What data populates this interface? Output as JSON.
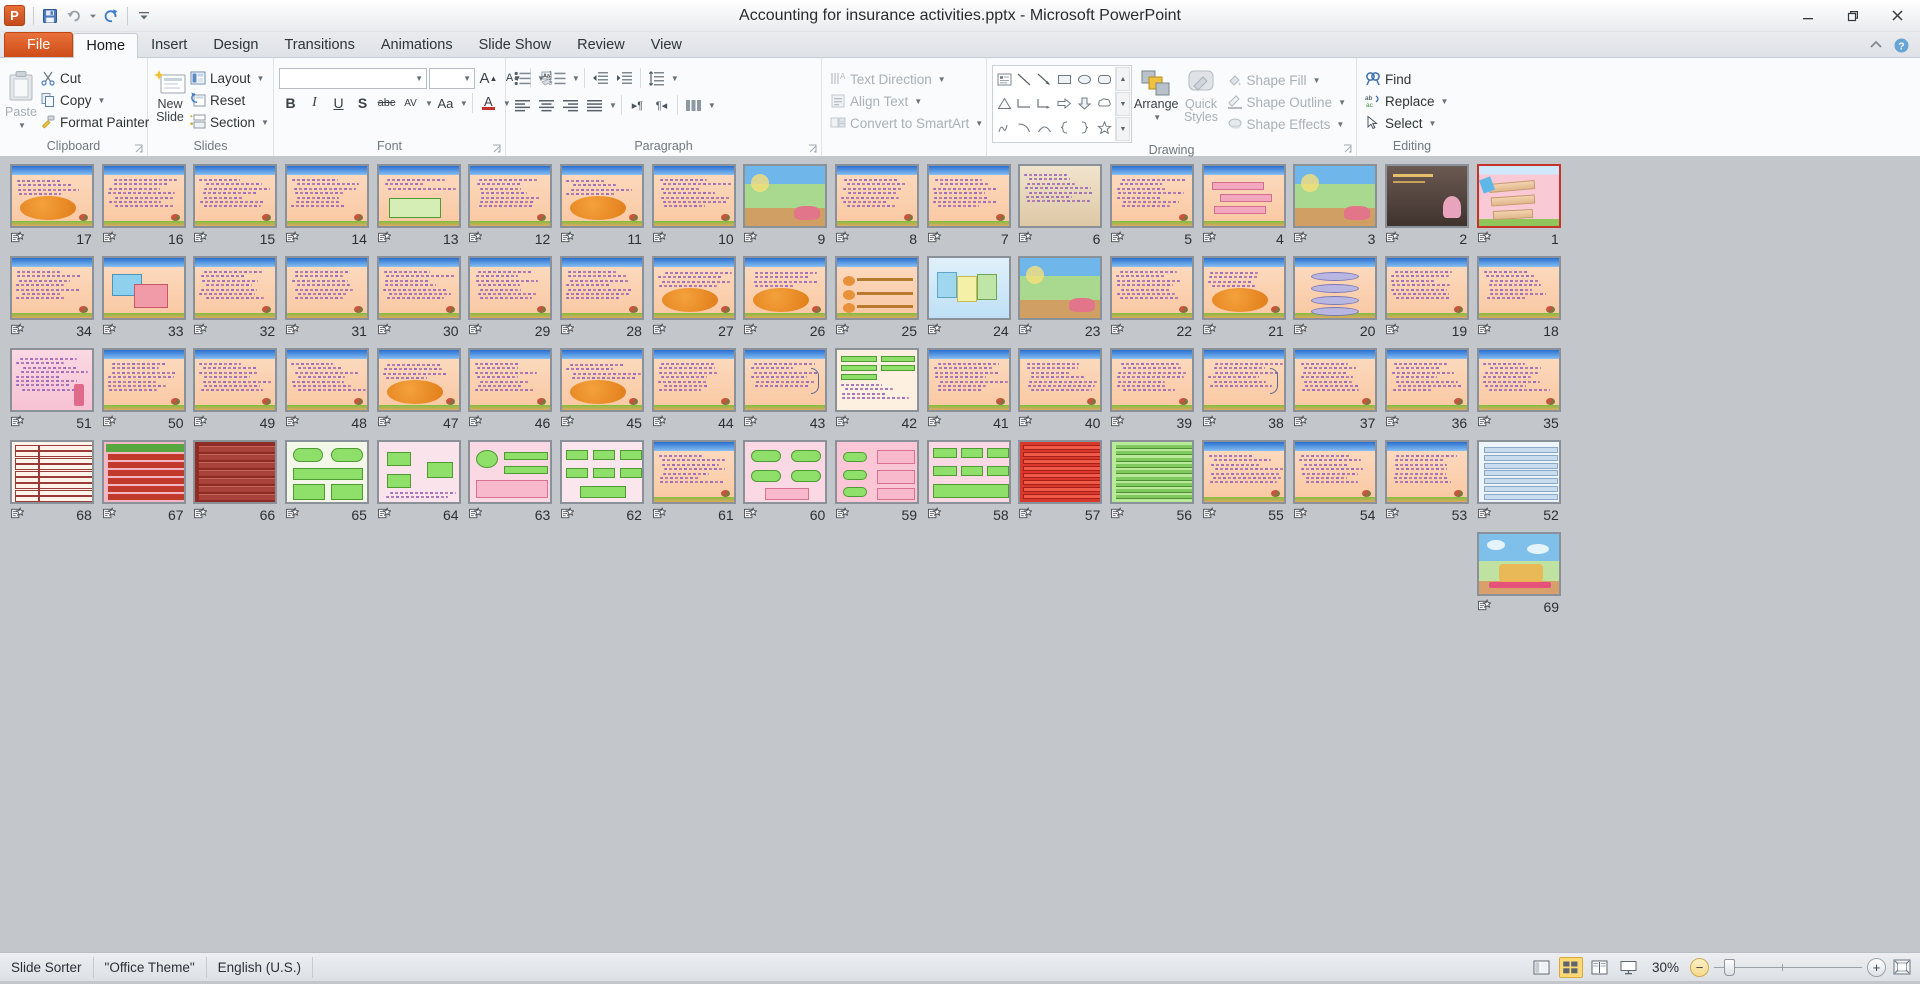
{
  "window": {
    "title": "Accounting for insurance activities.pptx  -  Microsoft PowerPoint",
    "minimize_label": "–",
    "restore_label": "❐",
    "close_label": "✕"
  },
  "quick_access": {
    "app_icon_letter": "P",
    "items": [
      {
        "name": "save-button",
        "label": "Save"
      },
      {
        "name": "undo-button",
        "label": "Undo"
      },
      {
        "name": "undo-dropdown",
        "label": "Undo options"
      },
      {
        "name": "redo-button",
        "label": "Redo"
      },
      {
        "name": "customize-qat-button",
        "label": "Customize Quick Access Toolbar"
      }
    ]
  },
  "tabs": [
    {
      "label": "File",
      "type": "file"
    },
    {
      "label": "Home",
      "type": "active"
    },
    {
      "label": "Insert",
      "type": "normal"
    },
    {
      "label": "Design",
      "type": "normal"
    },
    {
      "label": "Transitions",
      "type": "normal"
    },
    {
      "label": "Animations",
      "type": "normal"
    },
    {
      "label": "Slide Show",
      "type": "normal"
    },
    {
      "label": "Review",
      "type": "normal"
    },
    {
      "label": "View",
      "type": "normal"
    }
  ],
  "ribbon": {
    "groups": [
      {
        "title": "Clipboard"
      },
      {
        "title": "Slides"
      },
      {
        "title": "Font"
      },
      {
        "title": "Paragraph"
      },
      {
        "title": "Drawing"
      },
      {
        "title": "Editing"
      }
    ],
    "clipboard": {
      "paste_label": "Paste",
      "cut_label": "Cut",
      "copy_label": "Copy",
      "format_painter_label": "Format Painter"
    },
    "slides": {
      "new_slide_line1": "New",
      "new_slide_line2": "Slide",
      "layout_label": "Layout",
      "reset_label": "Reset",
      "section_label": "Section"
    },
    "font": {
      "font_name_value": "",
      "font_size_value": "",
      "bold": "B",
      "italic": "I",
      "underline": "U",
      "shadow": "S",
      "strikethrough": "abc",
      "char_spacing": "AV",
      "change_case": "Aa",
      "font_color": "A",
      "grow_font": "A",
      "shrink_font": "A",
      "clear_formatting": "Clear Formatting"
    },
    "paragraph": {
      "text_direction_label": "Text Direction",
      "align_text_label": "Align Text",
      "convert_smartart_label": "Convert to SmartArt"
    },
    "drawing": {
      "arrange_label": "Arrange",
      "quick_styles_line1": "Quick",
      "quick_styles_line2": "Styles",
      "shape_fill_label": "Shape Fill",
      "shape_outline_label": "Shape Outline",
      "shape_effects_label": "Shape Effects"
    },
    "editing": {
      "find_label": "Find",
      "replace_label": "Replace",
      "select_label": "Select"
    }
  },
  "status_bar": {
    "view_name": "Slide Sorter",
    "theme_name": "\"Office Theme\"",
    "language": "English (U.S.)",
    "zoom_level": "30%",
    "zoom_out_label": "−",
    "zoom_in_label": "+",
    "view_buttons": [
      {
        "name": "view-normal",
        "on": false
      },
      {
        "name": "view-slide-sorter",
        "on": true
      },
      {
        "name": "view-reading",
        "on": false
      },
      {
        "name": "view-slideshow",
        "on": false
      }
    ],
    "fit_window_label": "Fit slide to current window"
  },
  "slides": [
    {
      "n": "17",
      "style": "blob",
      "sel": false
    },
    {
      "n": "16",
      "style": "text",
      "sel": false
    },
    {
      "n": "15",
      "style": "text",
      "sel": false
    },
    {
      "n": "14",
      "style": "text",
      "sel": false
    },
    {
      "n": "13",
      "style": "greenpanel",
      "sel": false
    },
    {
      "n": "12",
      "style": "text",
      "sel": false
    },
    {
      "n": "11",
      "style": "blob",
      "sel": false
    },
    {
      "n": "10",
      "style": "text",
      "sel": false
    },
    {
      "n": "9",
      "style": "photo",
      "sel": false
    },
    {
      "n": "8",
      "style": "text",
      "sel": false
    },
    {
      "n": "7",
      "style": "text",
      "sel": false
    },
    {
      "n": "6",
      "style": "paper",
      "sel": false
    },
    {
      "n": "5",
      "style": "text",
      "sel": false
    },
    {
      "n": "4",
      "style": "banner",
      "sel": false
    },
    {
      "n": "3",
      "style": "photo",
      "sel": false
    },
    {
      "n": "2",
      "style": "dark",
      "sel": false
    },
    {
      "n": "1",
      "style": "title",
      "sel": true
    },
    {
      "n": "34",
      "style": "text",
      "sel": false
    },
    {
      "n": "33",
      "style": "card",
      "sel": false
    },
    {
      "n": "32",
      "style": "text",
      "sel": false
    },
    {
      "n": "31",
      "style": "text",
      "sel": false
    },
    {
      "n": "30",
      "style": "text",
      "sel": false
    },
    {
      "n": "29",
      "style": "text",
      "sel": false
    },
    {
      "n": "28",
      "style": "text",
      "sel": false
    },
    {
      "n": "27",
      "style": "blob",
      "sel": false
    },
    {
      "n": "26",
      "style": "blob",
      "sel": false
    },
    {
      "n": "25",
      "style": "chart",
      "sel": false
    },
    {
      "n": "24",
      "style": "sticky",
      "sel": false
    },
    {
      "n": "23",
      "style": "photo",
      "sel": false
    },
    {
      "n": "22",
      "style": "text",
      "sel": false
    },
    {
      "n": "21",
      "style": "blob",
      "sel": false
    },
    {
      "n": "20",
      "style": "stack",
      "sel": false
    },
    {
      "n": "19",
      "style": "text",
      "sel": false
    },
    {
      "n": "18",
      "style": "text",
      "sel": false
    },
    {
      "n": "51",
      "style": "pinktext",
      "sel": false
    },
    {
      "n": "50",
      "style": "text",
      "sel": false
    },
    {
      "n": "49",
      "style": "text",
      "sel": false
    },
    {
      "n": "48",
      "style": "text",
      "sel": false
    },
    {
      "n": "47",
      "style": "blob",
      "sel": false
    },
    {
      "n": "46",
      "style": "text",
      "sel": false
    },
    {
      "n": "45",
      "style": "blob",
      "sel": false
    },
    {
      "n": "44",
      "style": "text",
      "sel": false
    },
    {
      "n": "43",
      "style": "brace",
      "sel": false
    },
    {
      "n": "42",
      "style": "greentable",
      "sel": false
    },
    {
      "n": "41",
      "style": "text",
      "sel": false
    },
    {
      "n": "40",
      "style": "text",
      "sel": false
    },
    {
      "n": "39",
      "style": "text",
      "sel": false
    },
    {
      "n": "38",
      "style": "brace",
      "sel": false
    },
    {
      "n": "37",
      "style": "text",
      "sel": false
    },
    {
      "n": "36",
      "style": "text",
      "sel": false
    },
    {
      "n": "35",
      "style": "text",
      "sel": false
    },
    {
      "n": "68",
      "style": "redtable",
      "sel": false
    },
    {
      "n": "67",
      "style": "redgreen",
      "sel": false
    },
    {
      "n": "66",
      "style": "darkred",
      "sel": false
    },
    {
      "n": "65",
      "style": "greenflow",
      "sel": false
    },
    {
      "n": "64",
      "style": "greenarrow",
      "sel": false
    },
    {
      "n": "63",
      "style": "greenarrow2",
      "sel": false
    },
    {
      "n": "62",
      "style": "greenflow2",
      "sel": false
    },
    {
      "n": "61",
      "style": "text",
      "sel": false
    },
    {
      "n": "60",
      "style": "greenflow3",
      "sel": false
    },
    {
      "n": "59",
      "style": "pinkflow",
      "sel": false
    },
    {
      "n": "58",
      "style": "greenflow4",
      "sel": false
    },
    {
      "n": "57",
      "style": "redtable2",
      "sel": false
    },
    {
      "n": "56",
      "style": "greentable2",
      "sel": false
    },
    {
      "n": "55",
      "style": "text",
      "sel": false
    },
    {
      "n": "54",
      "style": "text",
      "sel": false
    },
    {
      "n": "53",
      "style": "text",
      "sel": false
    },
    {
      "n": "52",
      "style": "bluetable",
      "sel": false
    },
    {
      "n": "69",
      "style": "thanks",
      "sel": false,
      "offset": 16
    }
  ]
}
